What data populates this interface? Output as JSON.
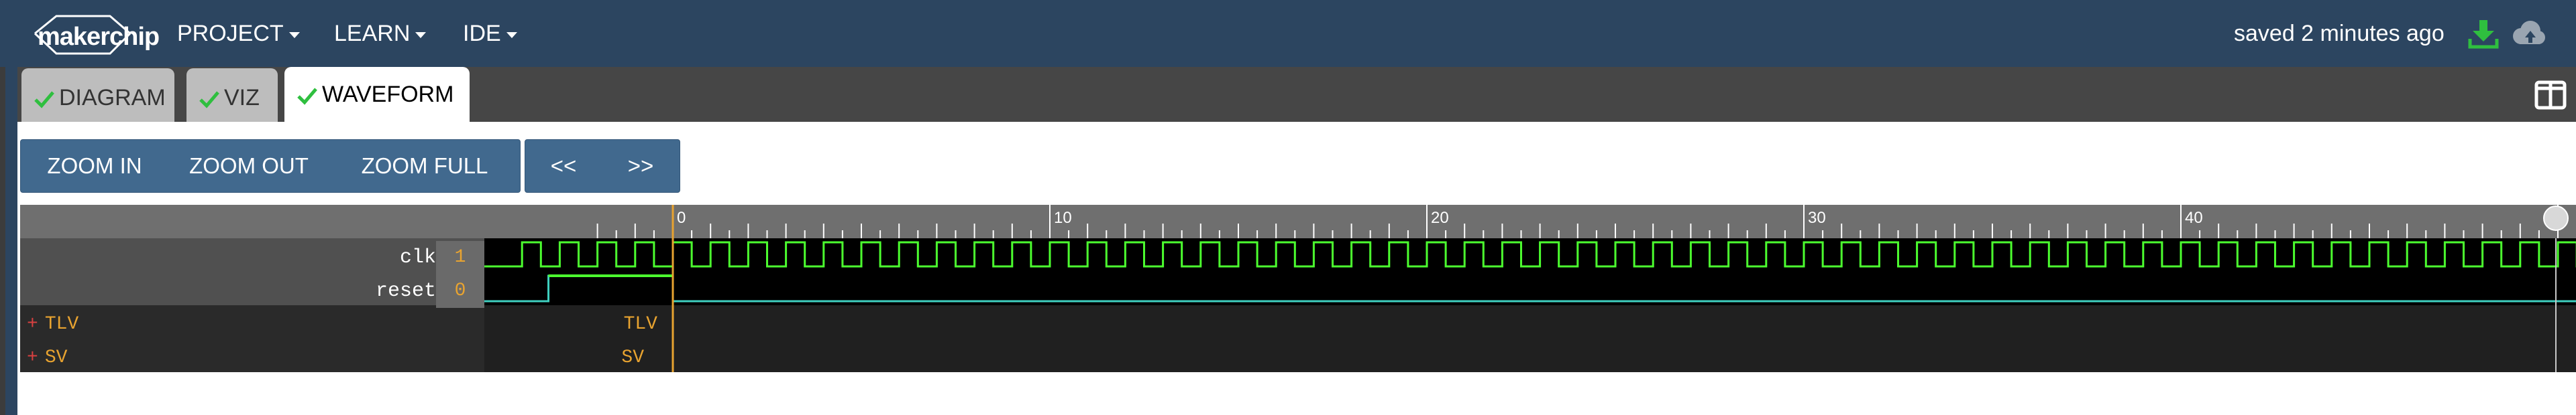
{
  "navbar": {
    "logo_text": "makerchip",
    "menus": [
      {
        "label": "PROJECT"
      },
      {
        "label": "LEARN"
      },
      {
        "label": "IDE"
      }
    ],
    "save_status": "saved 2 minutes ago",
    "download_icon": "download-icon",
    "cloud_icon": "cloud-upload-icon",
    "download_color": "#2fbf3f"
  },
  "tabs": [
    {
      "label": "DIAGRAM",
      "checked": true,
      "active": false
    },
    {
      "label": "VIZ",
      "checked": true,
      "active": false
    },
    {
      "label": "WAVEFORM",
      "checked": true,
      "active": true
    }
  ],
  "toolbar": {
    "zoom_in": "ZOOM IN",
    "zoom_out": "ZOOM OUT",
    "zoom_full": "ZOOM FULL",
    "prev": "<<",
    "next": ">>"
  },
  "waveform": {
    "ruler_labels": [
      "0",
      "10",
      "20",
      "30",
      "40"
    ],
    "signals": [
      {
        "name": "clk",
        "value": "1"
      },
      {
        "name": "reset",
        "value": "0"
      }
    ],
    "scopes": [
      {
        "name": "TLV",
        "label": "TLV"
      },
      {
        "name": "SV",
        "label": "SV"
      }
    ],
    "colors": {
      "clk_wave": "#4cff2f",
      "reset_wave": "#3fd0c0",
      "reset_high": "#4cff2f",
      "cursor": "#e8a330",
      "check": "#2fbf3f"
    }
  }
}
